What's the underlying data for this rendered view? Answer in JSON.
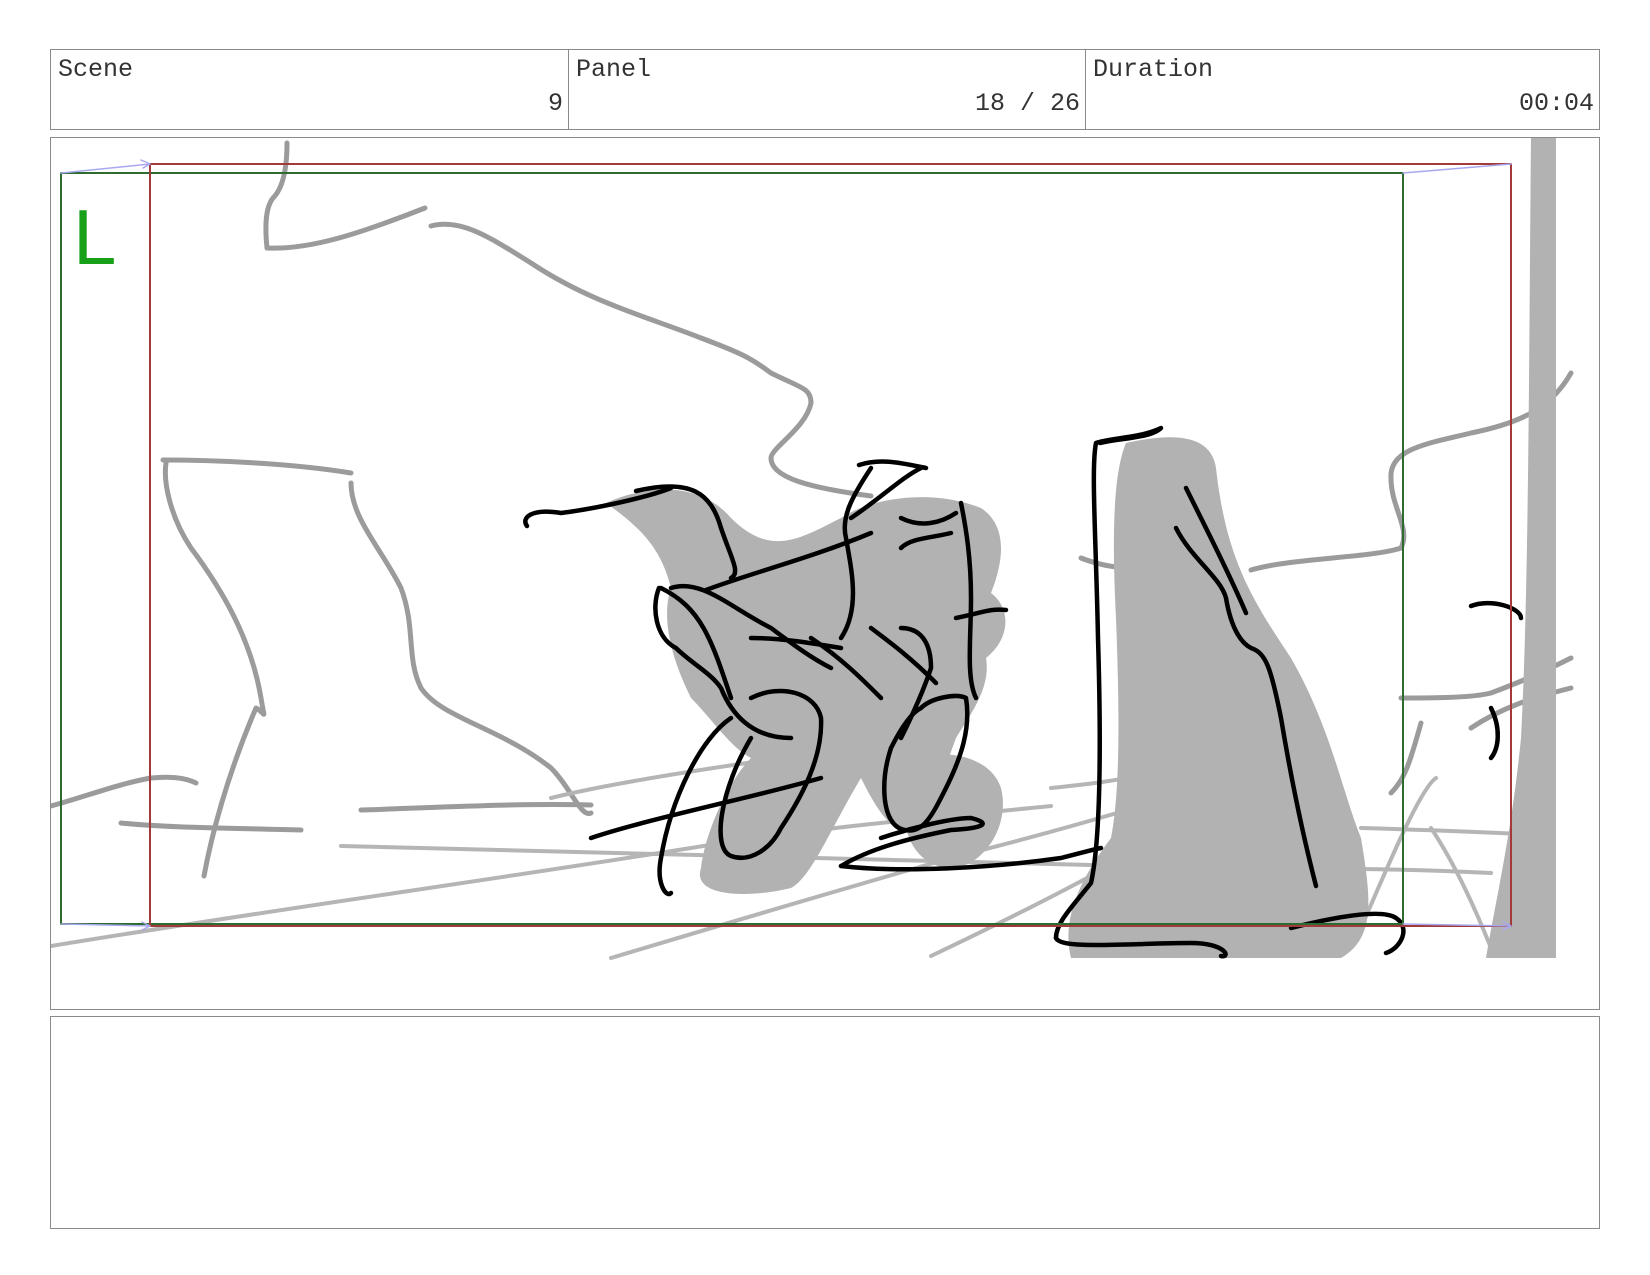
{
  "header": {
    "scene_label": "Scene",
    "scene_value": "9",
    "panel_label": "Panel",
    "panel_value": "18 / 26",
    "duration_label": "Duration",
    "duration_value": "00:04"
  },
  "frame": {
    "safe_area_label": "L",
    "colors": {
      "safe_area": "#2e6b2e",
      "safe_area_label": "#19a019",
      "camera_frame": "#a33a3a",
      "camera_move_arrow": "#a8a8ee",
      "sketch_line": "#000000",
      "sketch_gray": "#9b9b9b",
      "shadow_fill": "#b2b2b2"
    }
  },
  "notes": {
    "text": ""
  }
}
